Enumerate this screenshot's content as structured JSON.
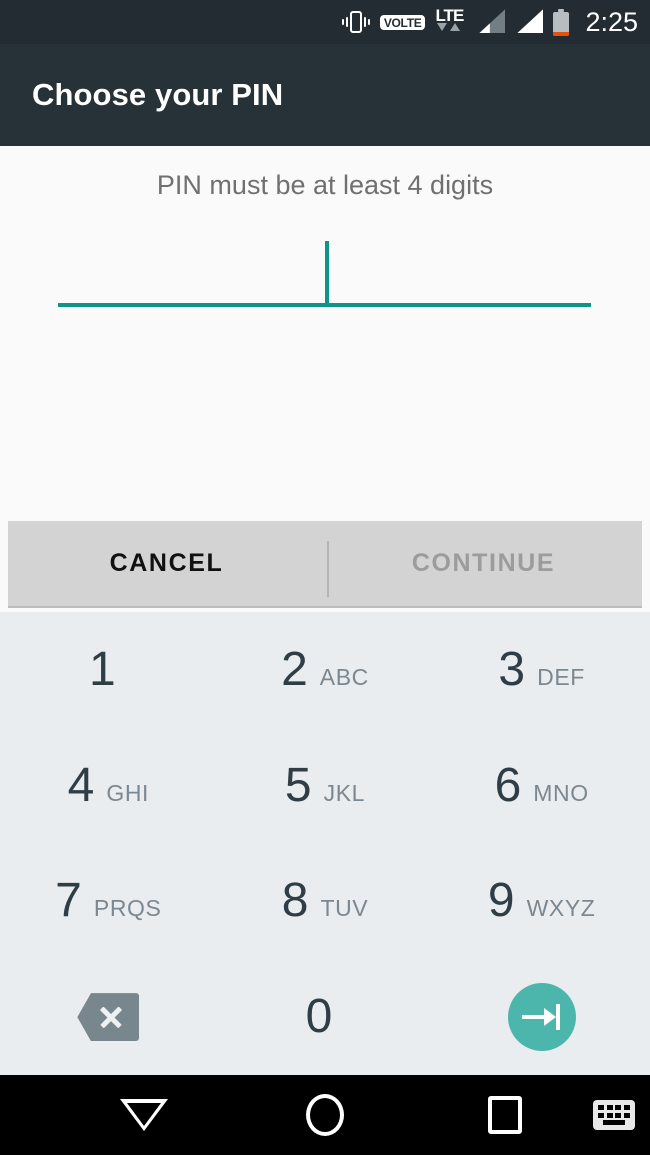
{
  "statusbar": {
    "icons": [
      "vibrate-icon",
      "volte-badge",
      "lte-icon",
      "signal-icon-1",
      "signal-icon-2",
      "battery-icon"
    ],
    "volte_label": "VOLTE",
    "network_label": "LTE",
    "clock": "2:25",
    "colors": {
      "background": "#232c32",
      "foreground": "#ffffff",
      "battery_low": "#e8500f",
      "signal_dim": "#737d84"
    }
  },
  "appbar": {
    "title": "Choose your PIN",
    "background": "#263238",
    "title_color": "#ffffff"
  },
  "content": {
    "hint": "PIN must be at least 4 digits",
    "pin_value": "",
    "accent_color": "#0f9488",
    "background": "#fafafa"
  },
  "actions": {
    "cancel_label": "CANCEL",
    "continue_label": "CONTINUE",
    "continue_enabled": false,
    "background": "#d3d3d3",
    "cancel_color": "#111111",
    "continue_color": "#9c9c9c"
  },
  "keypad": {
    "background": "#eaedef",
    "digit_color": "#2e3d46",
    "letter_color": "#7b8891",
    "enter_color": "#4db6ac",
    "backspace_color": "#78868d",
    "keys": [
      {
        "digit": "1",
        "letters": ""
      },
      {
        "digit": "2",
        "letters": "ABC"
      },
      {
        "digit": "3",
        "letters": "DEF"
      },
      {
        "digit": "4",
        "letters": "GHI"
      },
      {
        "digit": "5",
        "letters": "JKL"
      },
      {
        "digit": "6",
        "letters": "MNO"
      },
      {
        "digit": "7",
        "letters": "PRQS"
      },
      {
        "digit": "8",
        "letters": "TUV"
      },
      {
        "digit": "9",
        "letters": "WXYZ"
      },
      {
        "digit": "0",
        "letters": ""
      }
    ],
    "backspace_icon": "backspace-icon",
    "enter_icon": "enter-arrow-icon"
  },
  "navbar": {
    "background": "#000000",
    "items": [
      {
        "name": "back-icon"
      },
      {
        "name": "home-icon"
      },
      {
        "name": "recents-icon"
      },
      {
        "name": "keyboard-switch-icon"
      }
    ]
  }
}
